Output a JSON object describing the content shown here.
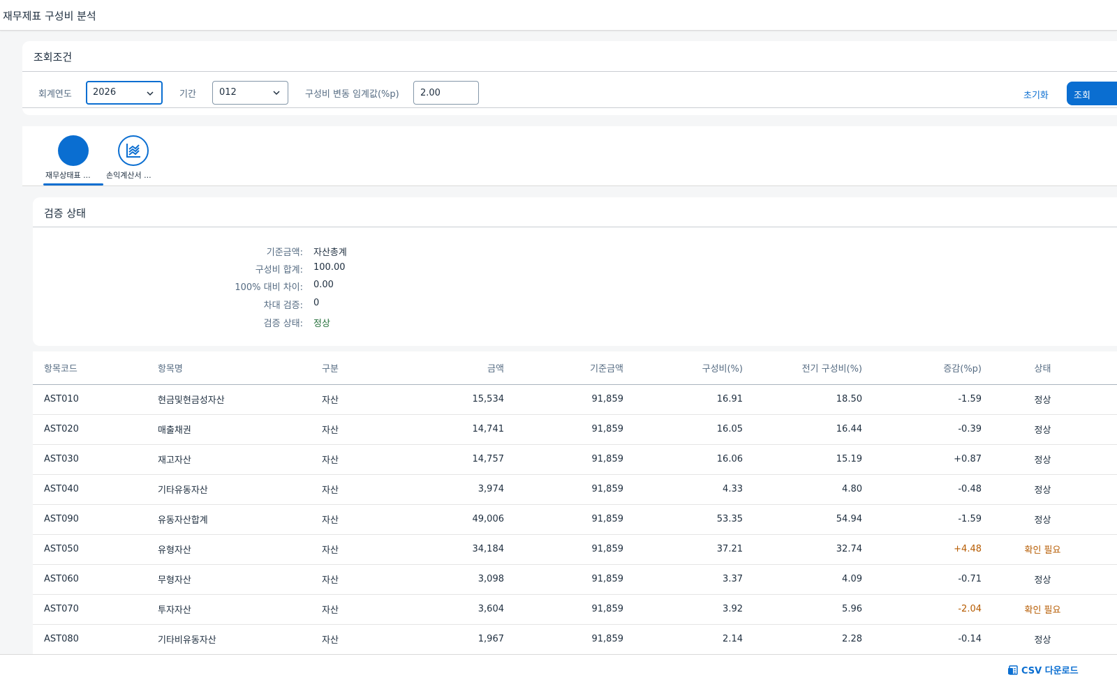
{
  "app": {
    "title": "재무제표 구성비 분석"
  },
  "filters": {
    "header": "조회조건",
    "fiscal_year_label": "회계연도",
    "fiscal_year_value": "2026",
    "period_label": "기간",
    "period_value": "012",
    "threshold_label": "구성비 변동 임계값(%p)",
    "threshold_value": "2.00",
    "reset_label": "초기화",
    "search_label": "조회"
  },
  "tabs": [
    {
      "label": "재무상태표 ...",
      "icon": "circle-filled-icon",
      "selected": true
    },
    {
      "label": "손익계산서 ...",
      "icon": "line-chart-icon",
      "selected": false
    }
  ],
  "status": {
    "header": "검증 상태",
    "rows": [
      {
        "label": "기준금액:",
        "value": "자산총계"
      },
      {
        "label": "구성비 합계:",
        "value": "100.00"
      },
      {
        "label": "100% 대비 차이:",
        "value": "0.00"
      },
      {
        "label": "차대 검증:",
        "value": "0"
      },
      {
        "label": "검증 상태:",
        "value": "정상"
      }
    ]
  },
  "table": {
    "columns": [
      "항목코드",
      "항목명",
      "구분",
      "금액",
      "기준금액",
      "구성비(%)",
      "전기 구성비(%)",
      "증감(%p)",
      "상태"
    ],
    "rows": [
      [
        "AST010",
        "현금및현금성자산",
        "자산",
        "15,534",
        "91,859",
        "16.91",
        "18.50",
        "-1.59",
        "정상"
      ],
      [
        "AST020",
        "매출채권",
        "자산",
        "14,741",
        "91,859",
        "16.05",
        "16.44",
        "-0.39",
        "정상"
      ],
      [
        "AST030",
        "재고자산",
        "자산",
        "14,757",
        "91,859",
        "16.06",
        "15.19",
        "+0.87",
        "정상"
      ],
      [
        "AST040",
        "기타유동자산",
        "자산",
        "3,974",
        "91,859",
        "4.33",
        "4.80",
        "-0.48",
        "정상"
      ],
      [
        "AST090",
        "유동자산합계",
        "자산",
        "49,006",
        "91,859",
        "53.35",
        "54.94",
        "-1.59",
        "정상"
      ],
      [
        "AST050",
        "유형자산",
        "자산",
        "34,184",
        "91,859",
        "37.21",
        "32.74",
        "+4.48",
        "확인 필요"
      ],
      [
        "AST060",
        "무형자산",
        "자산",
        "3,098",
        "91,859",
        "3.37",
        "4.09",
        "-0.71",
        "정상"
      ],
      [
        "AST070",
        "투자자산",
        "자산",
        "3,604",
        "91,859",
        "3.92",
        "5.96",
        "-2.04",
        "확인 필요"
      ],
      [
        "AST080",
        "기타비유동자산",
        "자산",
        "1,967",
        "91,859",
        "2.14",
        "2.28",
        "-0.14",
        "정상"
      ]
    ]
  },
  "footer": {
    "csv_label": "CSV 다운로드"
  },
  "colors": {
    "accent": "#0a6ed1",
    "warning": "#b65b00",
    "positive": "#256f3a"
  }
}
